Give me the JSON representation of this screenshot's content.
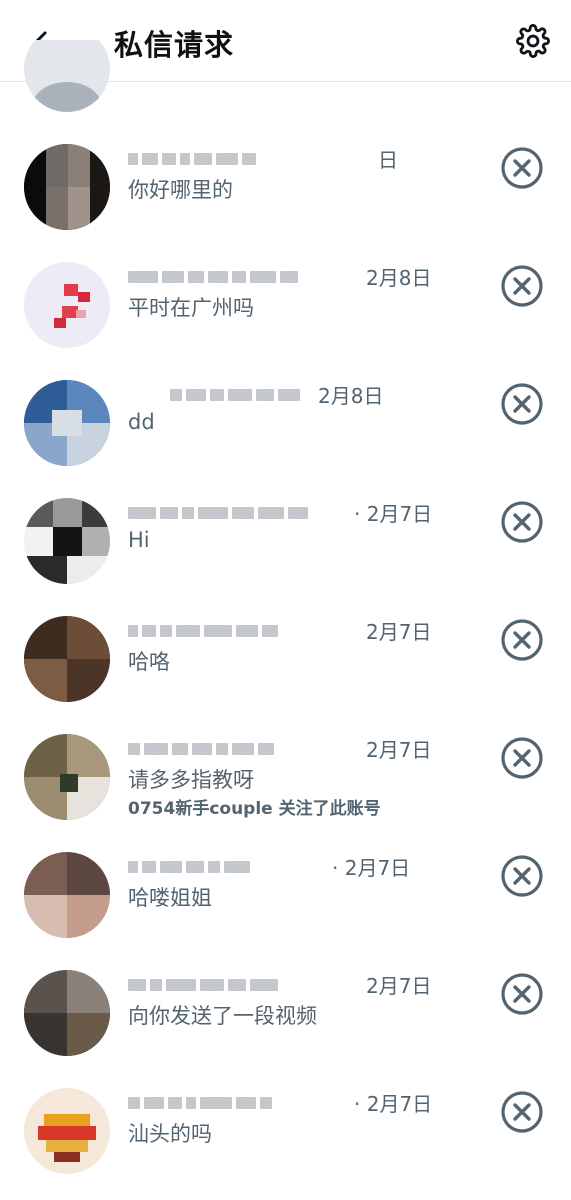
{
  "header": {
    "title": "私信请求",
    "back_icon": "arrow-left-icon",
    "settings_icon": "gear-icon"
  },
  "requests": [
    {
      "date": "日",
      "message": "你好哪里的",
      "followed": ""
    },
    {
      "date": "2月8日",
      "message": "平时在广州吗",
      "followed": ""
    },
    {
      "date": "2月8日",
      "message": "dd",
      "followed": ""
    },
    {
      "date": "· 2月7日",
      "message": "Hi",
      "followed": ""
    },
    {
      "date": "2月7日",
      "message": "哈咯",
      "followed": ""
    },
    {
      "date": "2月7日",
      "message": "请多多指教呀",
      "followed": "0754新手couple 关注了此账号"
    },
    {
      "date": "· 2月7日",
      "message": "哈喽姐姐",
      "followed": ""
    },
    {
      "date": "2月7日",
      "message": "向你发送了一段视频",
      "followed": ""
    },
    {
      "date": "· 2月7日",
      "message": "汕头的吗",
      "followed": ""
    }
  ],
  "colors": {
    "text_primary": "#0f1419",
    "text_secondary": "#536471",
    "icon": "#536471",
    "divider": "#e6e6e6"
  }
}
